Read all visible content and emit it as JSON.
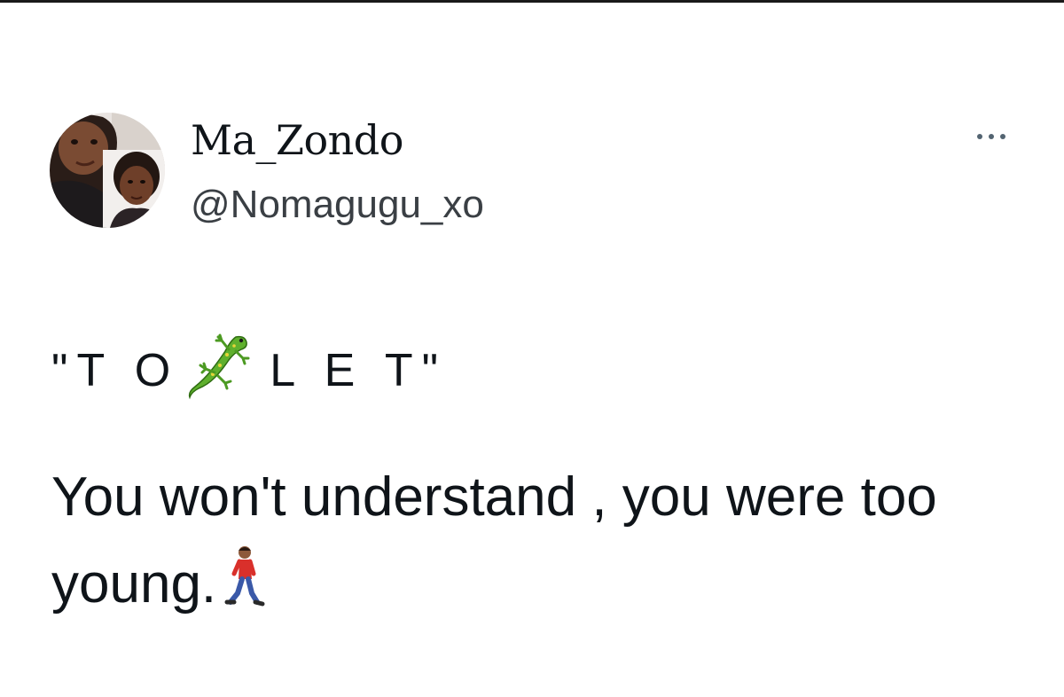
{
  "tweet": {
    "author": {
      "display_name": "Ma_Zondo",
      "handle": "@Nomagugu_xo",
      "avatar_icon": "profile-photo"
    },
    "more_icon": "more-dots-icon",
    "title_line": {
      "before": "\"T O",
      "emoji": "lizard-emoji",
      "after": "L E T\""
    },
    "body_text": "You won't understand , you were too young.",
    "body_emoji": "person-walking-emoji"
  },
  "colors": {
    "text": "#0f1419",
    "secondary": "#536471",
    "background": "#ffffff"
  }
}
